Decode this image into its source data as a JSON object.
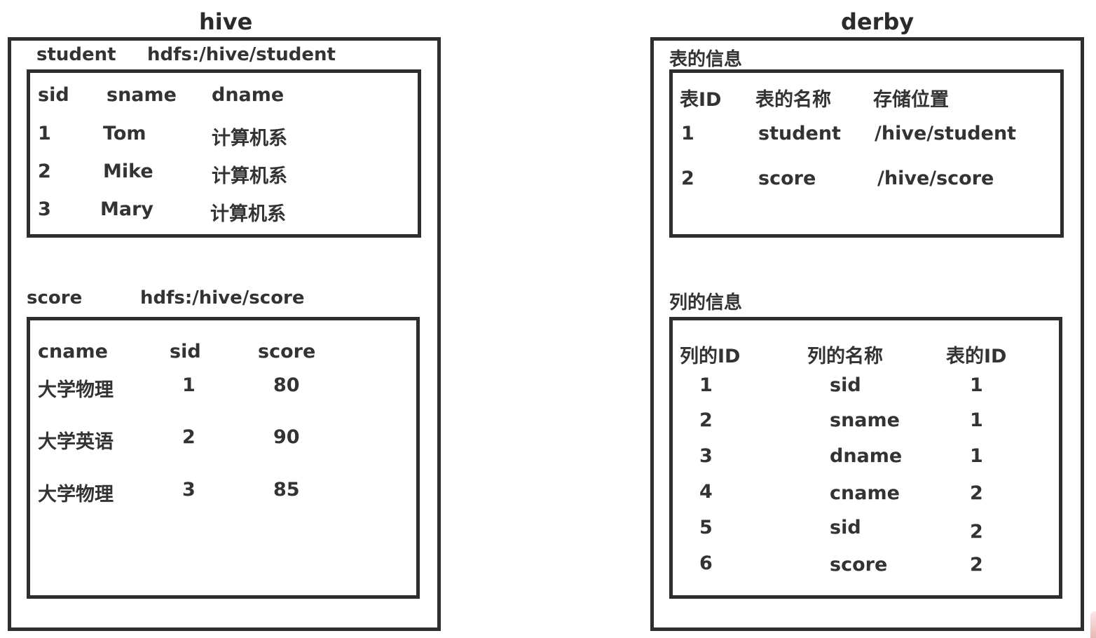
{
  "hive": {
    "title": "hive",
    "student": {
      "name": "student",
      "location": "hdfs:/hive/student",
      "columns": [
        "sid",
        "sname",
        "dname"
      ],
      "rows": [
        [
          "1",
          "Tom",
          "计算机系"
        ],
        [
          "2",
          "Mike",
          "计算机系"
        ],
        [
          "3",
          "Mary",
          "计算机系"
        ]
      ]
    },
    "score": {
      "name": "score",
      "location": "hdfs:/hive/score",
      "columns": [
        "cname",
        "sid",
        "score"
      ],
      "rows": [
        [
          "大学物理",
          "1",
          "80"
        ],
        [
          "大学英语",
          "2",
          "90"
        ],
        [
          "大学物理",
          "3",
          "85"
        ]
      ]
    }
  },
  "derby": {
    "title": "derby",
    "table_info": {
      "label": "表的信息",
      "columns": [
        "表ID",
        "表的名称",
        "存储位置"
      ],
      "rows": [
        [
          "1",
          "student",
          "/hive/student"
        ],
        [
          "2",
          "score",
          "/hive/score"
        ]
      ]
    },
    "column_info": {
      "label": "列的信息",
      "columns": [
        "列的ID",
        "列的名称",
        "表的ID"
      ],
      "rows": [
        [
          "1",
          "sid",
          "1"
        ],
        [
          "2",
          "sname",
          "1"
        ],
        [
          "3",
          "dname",
          "1"
        ],
        [
          "4",
          "cname",
          "2"
        ],
        [
          "5",
          "sid",
          "2"
        ],
        [
          "6",
          "score",
          "2"
        ]
      ]
    }
  }
}
